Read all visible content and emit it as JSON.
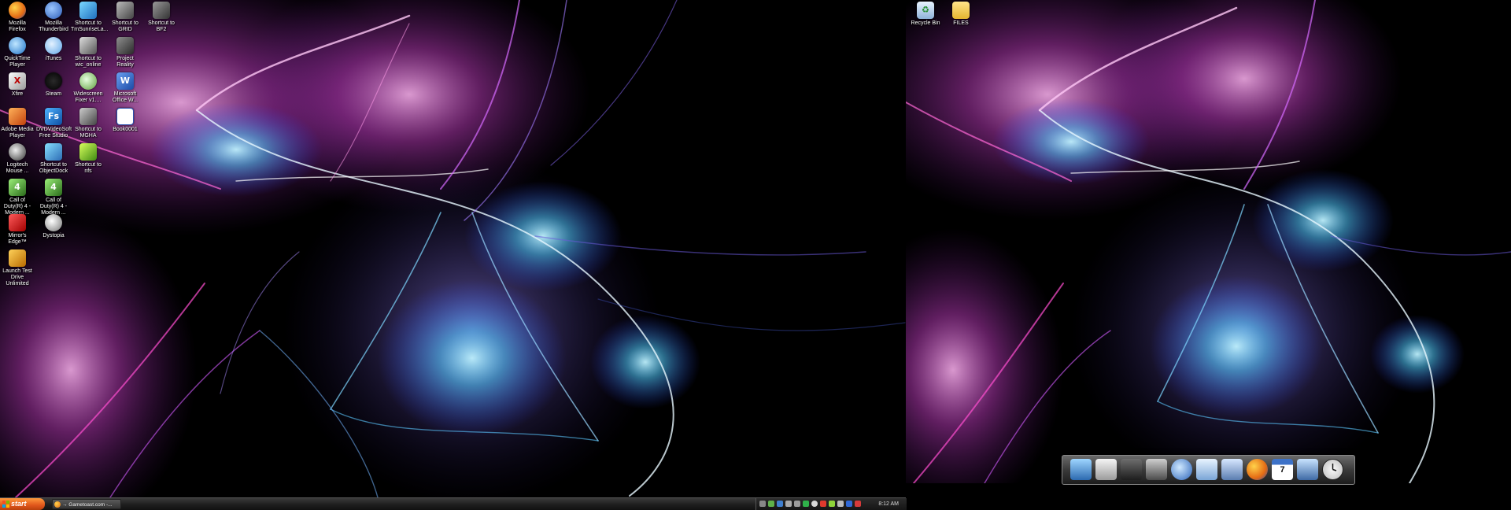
{
  "desktop_left": {
    "icons": [
      {
        "label": "Mozilla Firefox",
        "glyph": "firefox-icon"
      },
      {
        "label": "Mozilla Thunderbird",
        "glyph": "thunderbird-icon"
      },
      {
        "label": "Shortcut to TmSunriseLa...",
        "glyph": "tmsunrise-icon"
      },
      {
        "label": "Shortcut to GRID",
        "glyph": "grid-icon"
      },
      {
        "label": "Shortcut to BF2",
        "glyph": "bf2-icon"
      },
      {
        "label": "QuickTime Player",
        "glyph": "quicktime-icon"
      },
      {
        "label": "iTunes",
        "glyph": "itunes-icon"
      },
      {
        "label": "Shortcut to wic_online",
        "glyph": "wic-icon"
      },
      {
        "label": "Project Reality",
        "glyph": "project-reality-icon"
      },
      {
        "label": "Xfire",
        "glyph": "xfire-icon"
      },
      {
        "label": "Steam",
        "glyph": "steam-icon"
      },
      {
        "label": "Widescreen Fixer v1....",
        "glyph": "widescreen-fixer-icon"
      },
      {
        "label": "Microsoft Office W...",
        "glyph": "word-icon"
      },
      {
        "label": "Adobe Media Player",
        "glyph": "adobe-media-player-icon"
      },
      {
        "label": "DVDVideoSoft Free Studio",
        "glyph": "dvdvideosoft-icon"
      },
      {
        "label": "Shortcut to MGHA",
        "glyph": "mgha-icon"
      },
      {
        "label": "Book0001",
        "glyph": "book-icon"
      },
      {
        "label": "Logitech Mouse ...",
        "glyph": "logitech-icon"
      },
      {
        "label": "Shortcut to ObjectDock",
        "glyph": "objectdock-icon"
      },
      {
        "label": "Shortcut to nfs",
        "glyph": "nfs-icon"
      },
      {
        "label": "Call of Duty(R) 4 - Modern ...",
        "glyph": "cod4-icon"
      },
      {
        "label": "Call of Duty(R) 4 - Modern ...",
        "glyph": "cod4-mp-icon"
      },
      {
        "label": "Mirror's Edge™",
        "glyph": "mirrors-edge-icon"
      },
      {
        "label": "Dystopia",
        "glyph": "dystopia-icon"
      },
      {
        "label": "Launch Test Drive Unlimited",
        "glyph": "tdu-icon"
      }
    ]
  },
  "desktop_right": {
    "icons": [
      {
        "label": "Recycle Bin",
        "glyph": "recycle-bin-icon"
      },
      {
        "label": "FILES",
        "glyph": "folder-icon"
      }
    ]
  },
  "taskbar": {
    "start_label": "start",
    "task_label": "→ Gametoast.com -...",
    "clock": "8:12 AM"
  },
  "dock": {
    "items": [
      "monitor-icon",
      "document-icon",
      "camera-icon",
      "flashlight-icon",
      "globe-icon",
      "mail-icon",
      "pen-icon",
      "firefox-icon",
      "calendar-icon",
      "network-icon",
      "clock-icon"
    ],
    "calendar_date": "7"
  },
  "colors": {
    "taskbar": "#1e1e1e",
    "start": "#e0561b",
    "wallpaper_pink": "#d24ac8",
    "wallpaper_cyan": "#58d6ff",
    "wallpaper_violet": "#6b48d8"
  }
}
